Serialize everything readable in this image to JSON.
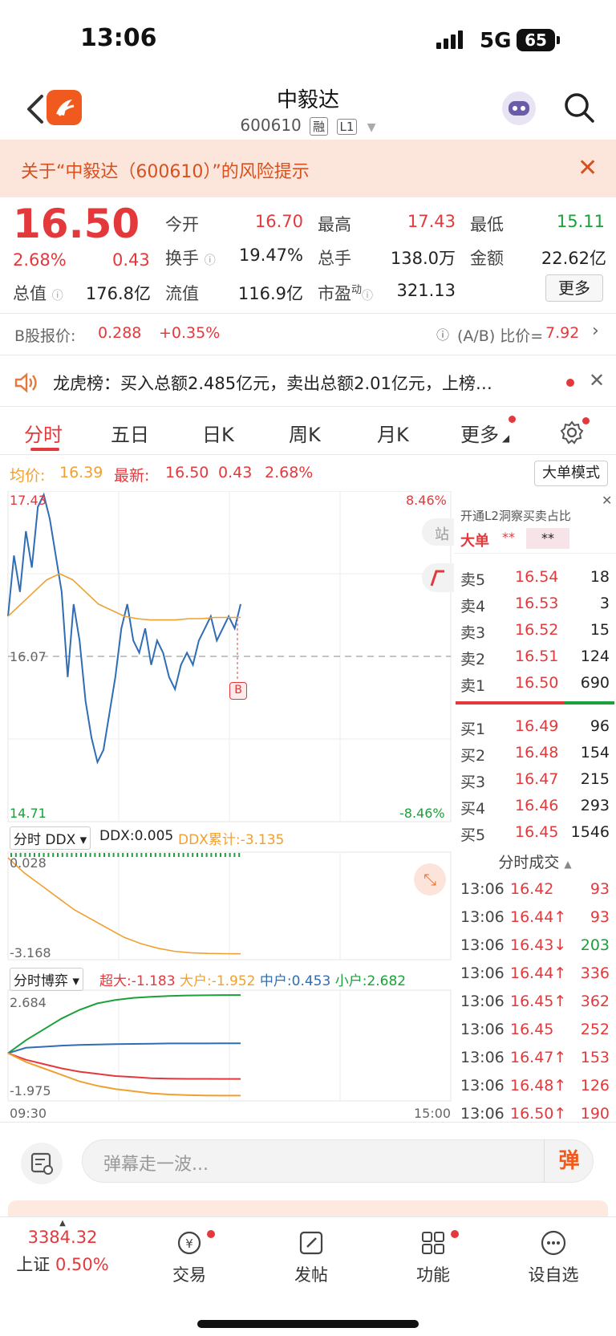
{
  "status_bar": {
    "time": "13:06",
    "network": "5G",
    "battery": "65"
  },
  "header": {
    "name": "中毅达",
    "code": "600610",
    "tag_margin": "融",
    "tag_level": "L1"
  },
  "risk_banner": {
    "text": "关于“中毅达（600610）”的风险提示"
  },
  "quote": {
    "price": "16.50",
    "pct": "2.68%",
    "change": "0.43",
    "open_label": "今开",
    "open": "16.70",
    "high_label": "最高",
    "high": "17.43",
    "low_label": "最低",
    "low": "15.11",
    "turnover_label": "换手",
    "turnover": "19.47%",
    "volume_label": "总手",
    "volume": "138.0万",
    "amount_label": "金额",
    "amount": "22.62亿",
    "total_val_label": "总值",
    "total_val": "176.8亿",
    "float_val_label": "流值",
    "float_val": "116.9亿",
    "pe_label": "市盈",
    "pe_sup": "动",
    "pe": "321.13",
    "more_label": "更多"
  },
  "b_share": {
    "label": "B股报价:",
    "price": "0.288",
    "pct": "+0.35%",
    "ratio_label": "(A/B) 比价=",
    "ratio": "7.92"
  },
  "lhb": {
    "text": "龙虎榜：买入总额2.485亿元，卖出总额2.01亿元，上榜…"
  },
  "tabs": [
    "分时",
    "五日",
    "日K",
    "周K",
    "月K",
    "更多"
  ],
  "avg_row": {
    "avg_label": "均价:",
    "avg": "16.39",
    "latest_label": "最新:",
    "latest": "16.50",
    "chg": "0.43",
    "pct": "2.68%",
    "bigorder_label": "大单模式"
  },
  "chart_data": {
    "type": "line",
    "y_top_label": "17.43",
    "y_mid_label": "16.07",
    "y_bottom_label": "14.71",
    "pct_top_label": "8.46%",
    "pct_bottom_label": "-8.46%",
    "ylim": [
      14.71,
      17.43
    ],
    "prev_close": 16.07,
    "x_start_label": "09:30",
    "x_end_label": "15:00",
    "series": [
      {
        "name": "最新",
        "color": "#2f6db5",
        "values": [
          16.4,
          16.9,
          16.6,
          17.1,
          16.8,
          17.3,
          17.4,
          17.2,
          16.9,
          16.6,
          15.9,
          16.5,
          16.2,
          15.7,
          15.4,
          15.2,
          15.3,
          15.6,
          15.9,
          16.3,
          16.5,
          16.2,
          16.1,
          16.3,
          16.0,
          16.2,
          16.1,
          15.9,
          15.8,
          16.0,
          16.1,
          16.0,
          16.2,
          16.3,
          16.4,
          16.2,
          16.3,
          16.4,
          16.3,
          16.5
        ]
      },
      {
        "name": "均价",
        "color": "#f0a030",
        "values": [
          16.4,
          16.5,
          16.6,
          16.7,
          16.75,
          16.7,
          16.6,
          16.5,
          16.45,
          16.4,
          16.38,
          16.37,
          16.37,
          16.37,
          16.38,
          16.38,
          16.39,
          16.39,
          16.39
        ]
      }
    ]
  },
  "ddx": {
    "label": "分时 DDX",
    "ddx_label": "DDX:",
    "ddx": "0.005",
    "acc_label": "DDX累计:",
    "acc": "-3.135",
    "y_top": "0.028",
    "y_bottom": "-3.168",
    "values": [
      0.0,
      -0.5,
      -0.9,
      -1.3,
      -1.7,
      -2.0,
      -2.3,
      -2.6,
      -2.8,
      -2.95,
      -3.05,
      -3.1,
      -3.12,
      -3.13,
      -3.135
    ]
  },
  "game": {
    "label": "分时博弈",
    "super_label": "超大:",
    "super": "-1.183",
    "big_label": "大户:",
    "big": "-1.952",
    "mid_label": "中户:",
    "mid": "0.453",
    "small_label": "小户:",
    "small": "2.682",
    "y_top": "2.684",
    "y_bottom": "-1.975",
    "series": {
      "small": [
        0.0,
        0.6,
        1.1,
        1.6,
        2.0,
        2.3,
        2.45,
        2.55,
        2.6,
        2.64,
        2.66,
        2.67,
        2.68,
        2.682
      ],
      "mid": [
        0.0,
        0.25,
        0.3,
        0.35,
        0.38,
        0.4,
        0.42,
        0.43,
        0.44,
        0.45,
        0.45,
        0.45,
        0.453,
        0.453
      ],
      "super": [
        0.0,
        -0.3,
        -0.5,
        -0.7,
        -0.85,
        -0.95,
        -1.05,
        -1.1,
        -1.15,
        -1.17,
        -1.18,
        -1.18,
        -1.183,
        -1.183
      ],
      "big": [
        0.0,
        -0.4,
        -0.7,
        -1.0,
        -1.3,
        -1.5,
        -1.65,
        -1.75,
        -1.85,
        -1.9,
        -1.93,
        -1.95,
        -1.952,
        -1.952
      ]
    }
  },
  "orderbook": {
    "promo": "开通L2洞察买卖占比",
    "big_label": "大单",
    "big_val1": "**",
    "big_val2": "**",
    "asks": [
      {
        "label": "卖5",
        "price": "16.54",
        "vol": "18"
      },
      {
        "label": "卖4",
        "price": "16.53",
        "vol": "3"
      },
      {
        "label": "卖3",
        "price": "16.52",
        "vol": "15"
      },
      {
        "label": "卖2",
        "price": "16.51",
        "vol": "124"
      },
      {
        "label": "卖1",
        "price": "16.50",
        "vol": "690"
      }
    ],
    "bids": [
      {
        "label": "买1",
        "price": "16.49",
        "vol": "96"
      },
      {
        "label": "买2",
        "price": "16.48",
        "vol": "154"
      },
      {
        "label": "买3",
        "price": "16.47",
        "vol": "215"
      },
      {
        "label": "买4",
        "price": "16.46",
        "vol": "293"
      },
      {
        "label": "买5",
        "price": "16.45",
        "vol": "1546"
      }
    ],
    "trades_label": "分时成交",
    "trades": [
      {
        "time": "13:06",
        "price": "16.42",
        "vol": "93"
      },
      {
        "time": "13:06",
        "price": "16.44↑",
        "vol": "93"
      },
      {
        "time": "13:06",
        "price": "16.43↓",
        "vol": "203"
      },
      {
        "time": "13:06",
        "price": "16.44↑",
        "vol": "336"
      },
      {
        "time": "13:06",
        "price": "16.45↑",
        "vol": "362"
      },
      {
        "time": "13:06",
        "price": "16.45",
        "vol": "252"
      },
      {
        "time": "13:06",
        "price": "16.47↑",
        "vol": "153"
      },
      {
        "time": "13:06",
        "price": "16.48↑",
        "vol": "126"
      },
      {
        "time": "13:06",
        "price": "16.50↑",
        "vol": "190"
      }
    ]
  },
  "comment": {
    "placeholder": "弹幕走一波...",
    "danmaku": "弹"
  },
  "tabbar": {
    "index_value": "3384.32",
    "index_name": "上证",
    "index_pct": "0.50%",
    "trade": "交易",
    "post": "发帖",
    "func": "功能",
    "watch": "设自选"
  }
}
